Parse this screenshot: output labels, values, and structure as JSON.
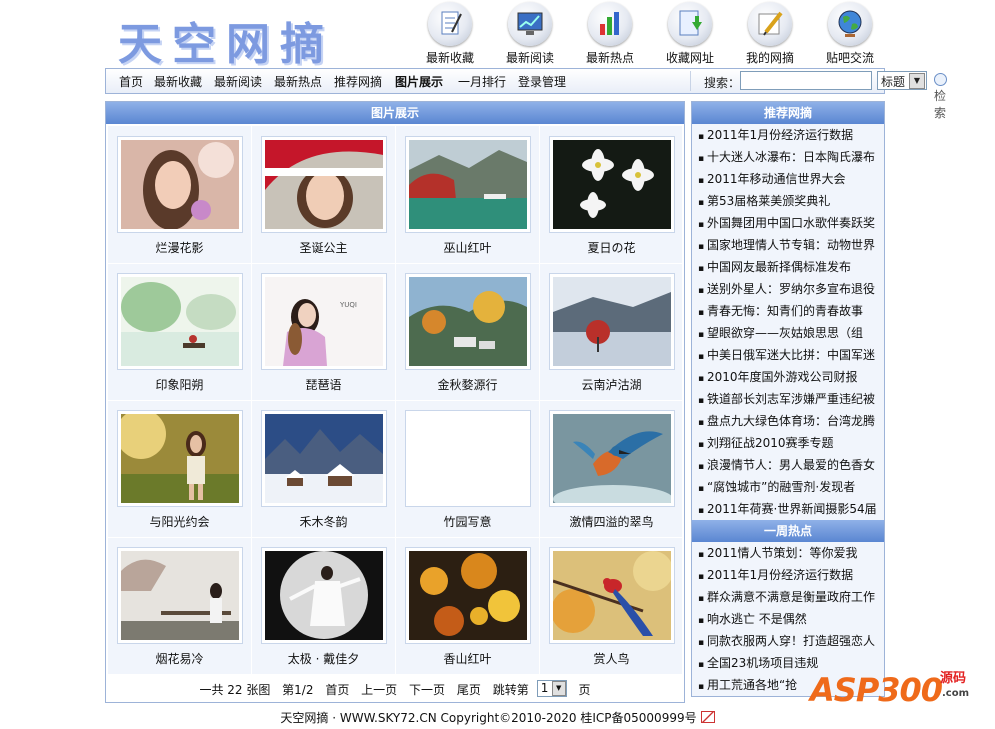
{
  "header": {
    "logo_text": "天空网摘",
    "nav_icons": [
      {
        "label": "最新收藏",
        "icon": "notepad-icon"
      },
      {
        "label": "最新阅读",
        "icon": "monitor-chart-icon"
      },
      {
        "label": "最新热点",
        "icon": "bar-chart-icon"
      },
      {
        "label": "收藏网址",
        "icon": "document-download-icon"
      },
      {
        "label": "我的网摘",
        "icon": "pencil-note-icon"
      },
      {
        "label": "贴吧交流",
        "icon": "globe-icon"
      }
    ]
  },
  "navbar": {
    "links": [
      "首页",
      "最新收藏",
      "最新阅读",
      "最新热点",
      "推荐网摘",
      "图片展示",
      "一月排行",
      "登录管理"
    ],
    "active": "图片展示",
    "search_label": "搜索：",
    "search_value": "",
    "search_select": "标题",
    "search_button": "检索"
  },
  "gallery": {
    "title": "图片展示",
    "items": [
      {
        "caption": "烂漫花影"
      },
      {
        "caption": "圣诞公主"
      },
      {
        "caption": "巫山红叶"
      },
      {
        "caption": "夏日の花"
      },
      {
        "caption": "印象阳朔"
      },
      {
        "caption": "琵琶语"
      },
      {
        "caption": "金秋婺源行"
      },
      {
        "caption": "云南泸沽湖"
      },
      {
        "caption": "与阳光约会"
      },
      {
        "caption": "禾木冬韵"
      },
      {
        "caption": "竹园写意"
      },
      {
        "caption": "激情四溢的翠鸟"
      },
      {
        "caption": "烟花易冷"
      },
      {
        "caption": "太极 · 戴佳夕"
      },
      {
        "caption": "香山红叶"
      },
      {
        "caption": "赏人鸟"
      }
    ],
    "pager": {
      "total": "一共 22 张图",
      "page": "第1/2",
      "first": "首页",
      "prev": "上一页",
      "next": "下一页",
      "last": "尾页",
      "jump_label": "跳转第",
      "jump_value": "1",
      "jump_suffix": "页"
    }
  },
  "sidebar": {
    "recommend_title": "推荐网摘",
    "recommend": [
      "2011年1月份经济运行数据",
      "十大迷人冰瀑布：日本陶氏瀑布",
      "2011年移动通信世界大会",
      "第53届格莱美颁奖典礼",
      "外国舞团用中国口水歌伴奏跃奖",
      "国家地理情人节专辑：动物世界",
      "中国网友最新择偶标准发布",
      "送别外星人：罗纳尔多宣布退役",
      "青春无悔：知青们的青春故事",
      "望眼欲穿——灰姑娘思思（组",
      "中美日俄军迷大比拼：中国军迷",
      "2010年度国外游戏公司财报",
      "铁道部长刘志军涉嫌严重违纪被",
      "盘点九大绿色体育场：台湾龙腾",
      "刘翔征战2010赛季专题",
      "浪漫情节人：男人最爱的色香女",
      "“腐蚀城市”的融雪剂·发现者",
      "2011年荷赛·世界新闻摄影54届"
    ],
    "hot_title": "一周热点",
    "hot": [
      "2011情人节策划：等你爱我",
      "2011年1月份经济运行数据",
      "群众满意不满意是衡量政府工作",
      "响水逃亡 不是偶然",
      "同款衣服两人穿！打造超强恋人",
      "全国23机场项目违规",
      "用工荒通各地“抢"
    ]
  },
  "footer": {
    "text": "天空网摘 · WWW.SKY72.CN Copyright©2010-2020 桂ICP备05000999号"
  },
  "watermark": {
    "brand": "ASP300",
    "tag": "源码",
    "domain": ".com"
  }
}
